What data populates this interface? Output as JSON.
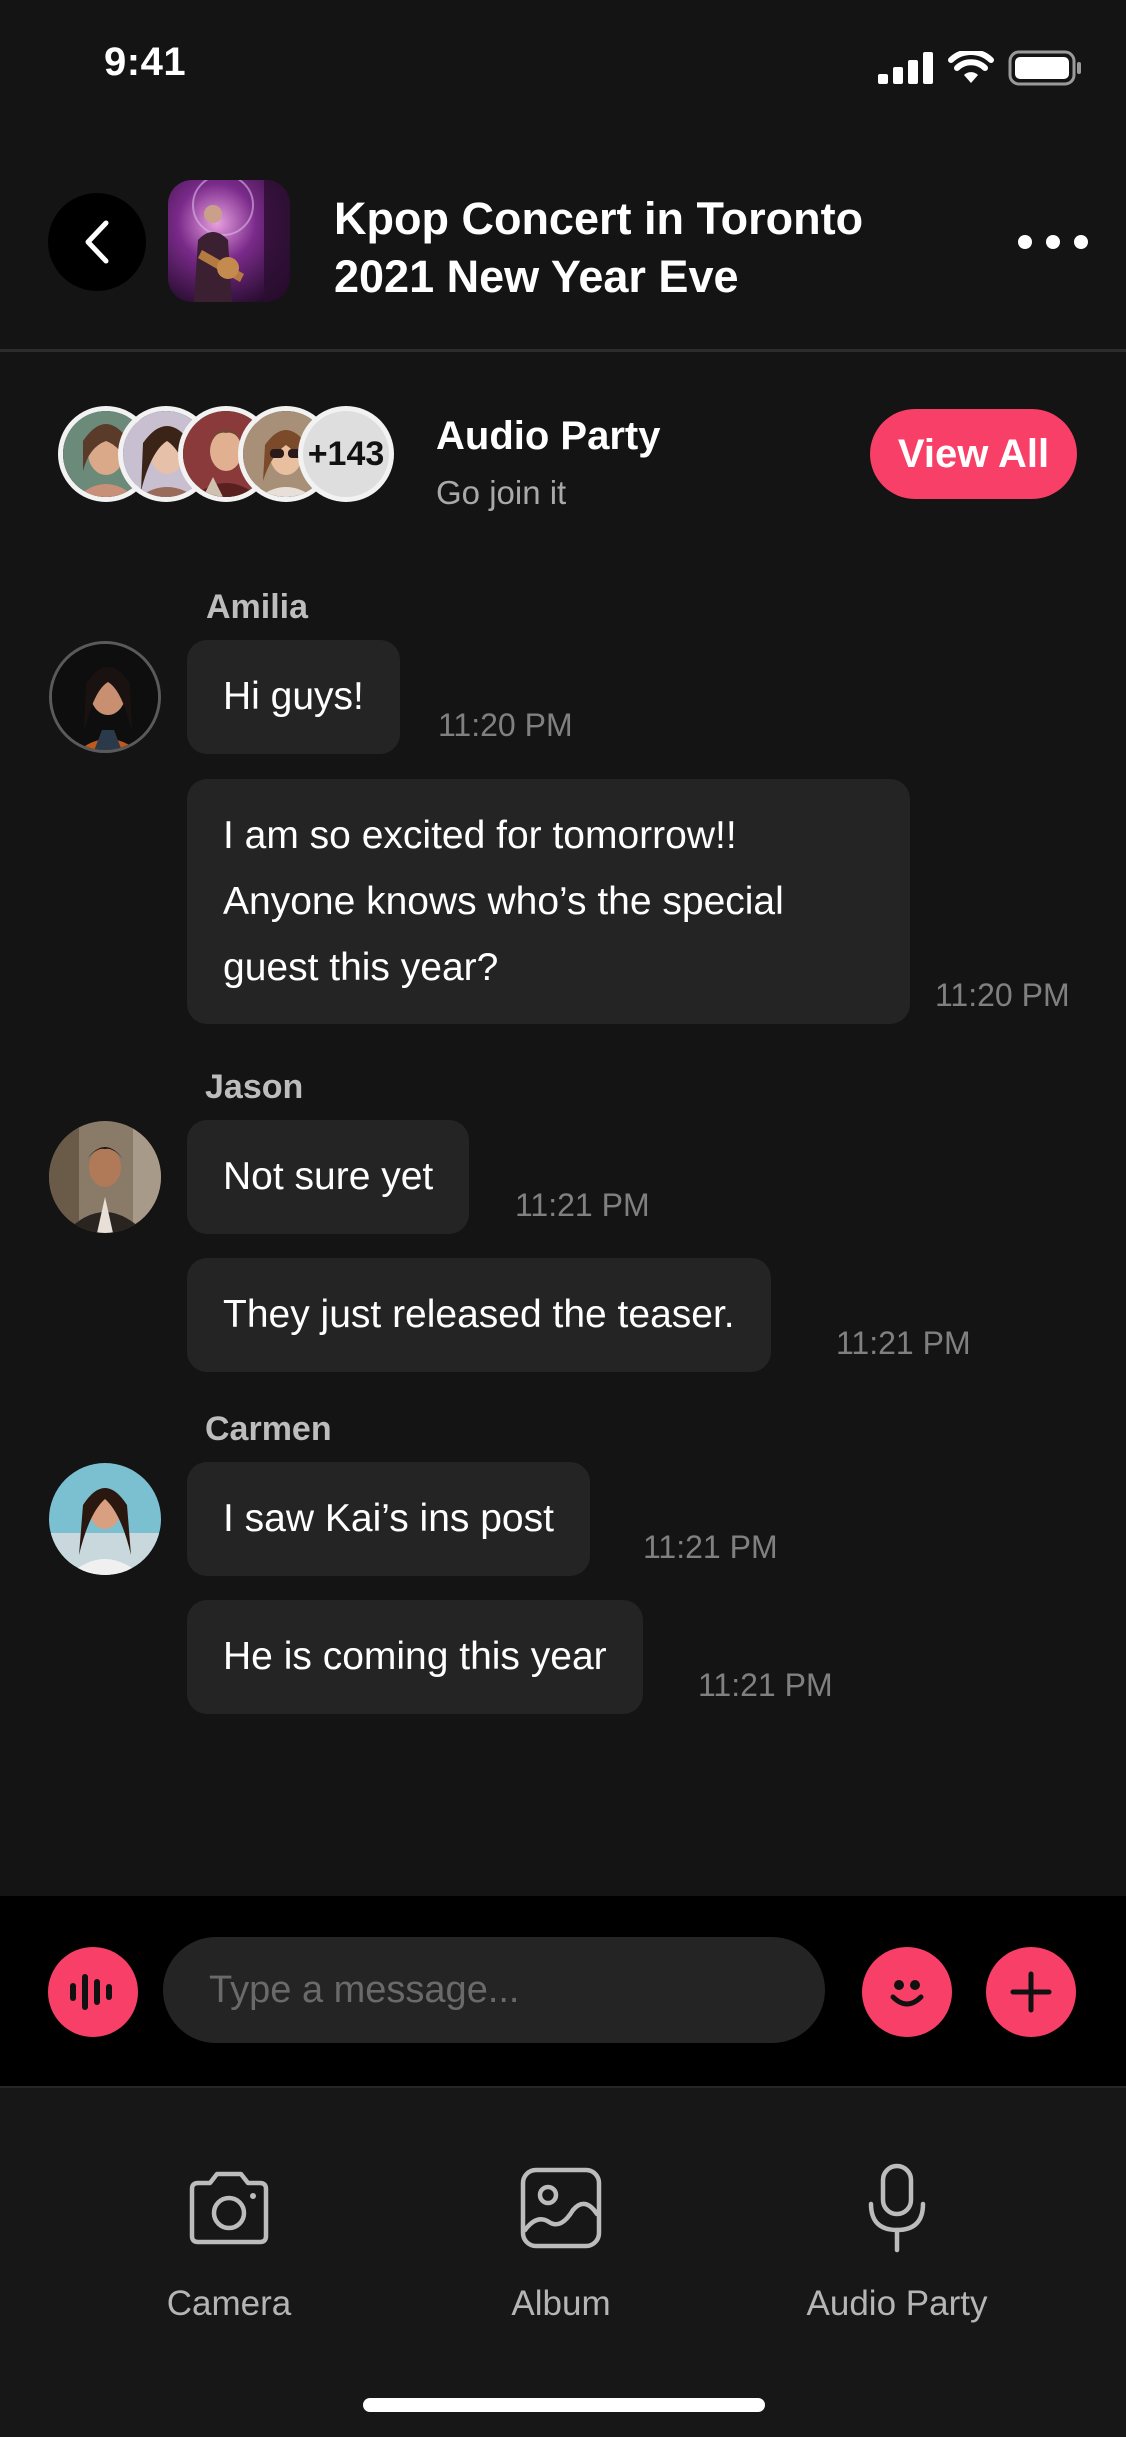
{
  "status_bar": {
    "time": "9:41"
  },
  "header": {
    "title_line1": "Kpop Concert in Toronto",
    "title_line2": "2021 New Year Eve"
  },
  "audio_party": {
    "member_count": "+143",
    "title": "Audio Party",
    "subtitle": "Go join it",
    "view_all": "View All"
  },
  "messages": [
    {
      "sender": "Amilia",
      "bubbles": [
        {
          "lines": [
            "Hi guys!"
          ],
          "time": "11:20 PM"
        },
        {
          "lines": [
            "I am so excited for tomorrow!!",
            "Anyone knows who’s the special",
            "guest this year?"
          ],
          "time": "11:20 PM"
        }
      ]
    },
    {
      "sender": "Jason",
      "bubbles": [
        {
          "lines": [
            "Not sure yet"
          ],
          "time": "11:21 PM"
        },
        {
          "lines": [
            "They just released the teaser."
          ],
          "time": "11:21 PM"
        }
      ]
    },
    {
      "sender": "Carmen",
      "bubbles": [
        {
          "lines": [
            "I saw Kai’s ins post"
          ],
          "time": "11:21 PM"
        },
        {
          "lines": [
            "He is coming this year"
          ],
          "time": "11:21 PM"
        }
      ]
    }
  ],
  "composer": {
    "placeholder": "Type a message..."
  },
  "tabs": [
    {
      "label": "Camera",
      "icon": "camera-icon"
    },
    {
      "label": "Album",
      "icon": "image-icon"
    },
    {
      "label": "Audio Party",
      "icon": "microphone-icon"
    }
  ],
  "colors": {
    "accent": "#f73f67",
    "background": "#141414",
    "bubble": "#242424"
  }
}
